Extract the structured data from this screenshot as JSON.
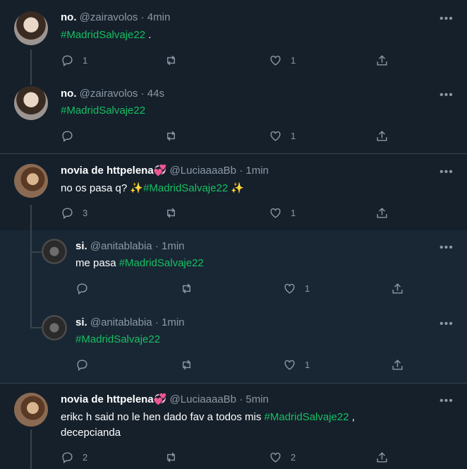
{
  "tweets": [
    {
      "name": "no.",
      "handle": "@zairavolos",
      "time": "4min",
      "text": "",
      "hashtag": "#MadridSalvaje22",
      "text_after": " .",
      "replies": "1",
      "retweets": "",
      "likes": "1"
    },
    {
      "name": "no.",
      "handle": "@zairavolos",
      "time": "44s",
      "text": "",
      "hashtag": "#MadridSalvaje22",
      "text_after": "",
      "replies": "",
      "retweets": "",
      "likes": "1"
    },
    {
      "name": "novia de httpelena💞",
      "handle": "@LuciaaaaBb",
      "time": "1min",
      "text": "no os pasa q? ✨",
      "hashtag": "#MadridSalvaje22",
      "text_after": " ✨",
      "replies": "3",
      "retweets": "",
      "likes": "1"
    },
    {
      "name": "si.",
      "handle": "@anitablabia",
      "time": "1min",
      "text": "me pasa ",
      "hashtag": "#MadridSalvaje22",
      "text_after": "",
      "replies": "",
      "retweets": "",
      "likes": "1"
    },
    {
      "name": "si.",
      "handle": "@anitablabia",
      "time": "1min",
      "text": "",
      "hashtag": "#MadridSalvaje22",
      "text_after": "",
      "replies": "",
      "retweets": "",
      "likes": "1"
    },
    {
      "name": "novia de httpelena💞",
      "handle": "@LuciaaaaBb",
      "time": "5min",
      "text": "erikc h said no le hen dado fav a todos mis ",
      "hashtag": "#MadridSalvaje22",
      "text_after": " ,",
      "text_line2": "decepcianda",
      "replies": "2",
      "retweets": "",
      "likes": "2"
    }
  ],
  "separator": "·",
  "more_label": "•••",
  "colors": {
    "background": "#15202b",
    "hashtag": "#17bf63",
    "muted": "#8b98a5",
    "divider": "#38444d"
  },
  "icons": [
    "reply-icon",
    "retweet-icon",
    "like-icon",
    "share-icon",
    "more-icon"
  ]
}
